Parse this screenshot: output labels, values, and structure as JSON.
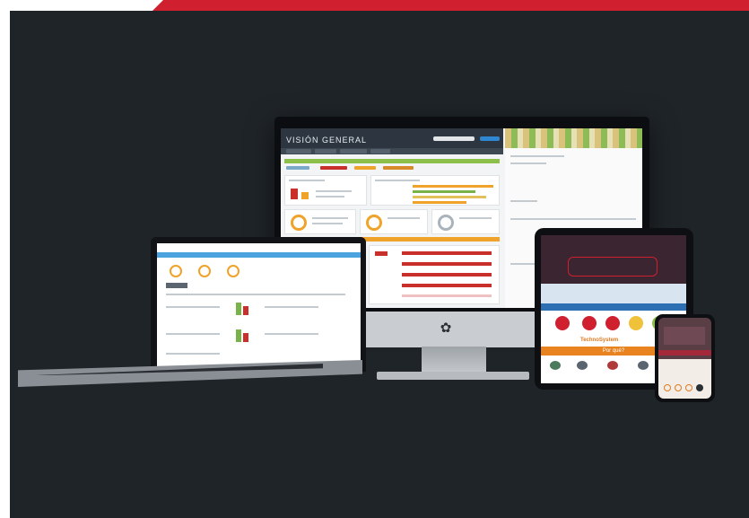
{
  "colors": {
    "panel_background": "#1f2428",
    "accent_red": "#d0202f",
    "dashboard_orange": "#f0a32a",
    "dashboard_green": "#8dc04a"
  },
  "devices": {
    "monitor": {
      "dashboard": {
        "title": "VISIÓN GENERAL"
      },
      "logo_icon": "logo-icon"
    },
    "laptop": {},
    "tablet": {
      "brand": "TechnoSystem",
      "cta": "Por qué?"
    },
    "phone": {}
  }
}
